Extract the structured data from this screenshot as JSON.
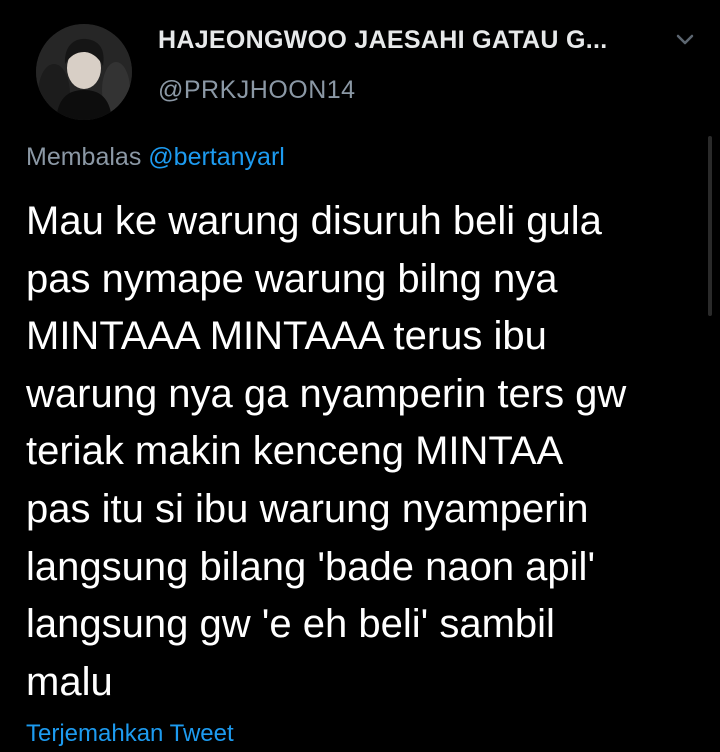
{
  "tweet": {
    "display_name": "HAJEONGWOO JAESAHI GATAU G...",
    "handle": "@PRKJHOON14",
    "reply_prefix": "Membalas",
    "reply_to": "@bertanyarl",
    "body_lines": [
      "Mau ke warung disuruh beli gula",
      "pas nymape warung bilng nya",
      "MINTAAA MINTAAA terus ibu",
      "warung nya ga nyamperin ters gw",
      "teriak makin kenceng MINTAA",
      "pas itu si ibu warung nyamperin",
      "langsung bilang 'bade naon apil'",
      "langsung gw 'e eh beli' sambil",
      "malu"
    ],
    "translate_label": "Terjemahkan Tweet"
  },
  "icons": {
    "avatar": "profile-photo",
    "menu": "chevron-down-icon"
  },
  "colors": {
    "background": "#000000",
    "primary_text": "#ffffff",
    "secondary_text": "#8b98a5",
    "link": "#1d9bf0"
  }
}
